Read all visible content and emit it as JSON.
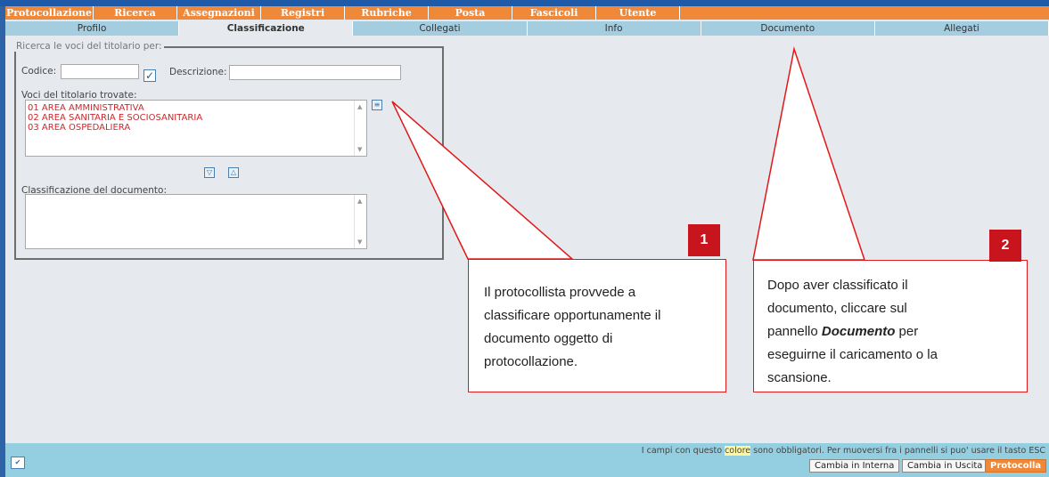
{
  "menubar": [
    "Protocollazione",
    "Ricerca",
    "Assegnazioni",
    "Registri",
    "Rubriche",
    "Posta",
    "Fascicoli",
    "Utente"
  ],
  "tabs": [
    "Profilo",
    "Classificazione",
    "Collegati",
    "Info",
    "Documento",
    "Allegati"
  ],
  "active_tab": "Classificazione",
  "search": {
    "legend": "Ricerca le voci del titolario per:",
    "codice_label": "Codice:",
    "codice_value": "",
    "descrizione_label": "Descrizione:",
    "descrizione_value": "",
    "checked": true
  },
  "voci": {
    "label": "Voci del titolario trovate:",
    "items": [
      "01 AREA AMMINISTRATIVA",
      "02 AREA SANITARIA E SOCIOSANITARIA",
      "03 AREA OSPEDALIERA"
    ]
  },
  "classificazione": {
    "label": "Classificazione del documento:",
    "value": ""
  },
  "callout1": {
    "number": "1",
    "lines": [
      "Il protocollista provvede a",
      "classificare opportunamente il",
      "documento oggetto di",
      "protocollazione."
    ]
  },
  "callout2": {
    "number": "2",
    "line1": "Dopo aver classificato il",
    "line2": "documento, cliccare sul",
    "line3_prefix": "pannello ",
    "line3_emph": "Documento",
    "line3_suffix": " per",
    "line4": "eseguirne il caricamento o la",
    "line5": "scansione."
  },
  "status": {
    "pre": "I campi con questo ",
    "chip": "colore",
    "post": " sono obbligatori. Per muoversi fra i pannelli si puo' usare il tasto ESC"
  },
  "buttons": {
    "interna": "Cambia in Interna",
    "uscita": "Cambia in Uscita",
    "protocolla": "Protocolla"
  },
  "colors": {
    "menubar": "#f0883a",
    "tab": "#a5cde0",
    "statusbar": "#93cfe0",
    "callout_red": "#c8141c"
  }
}
